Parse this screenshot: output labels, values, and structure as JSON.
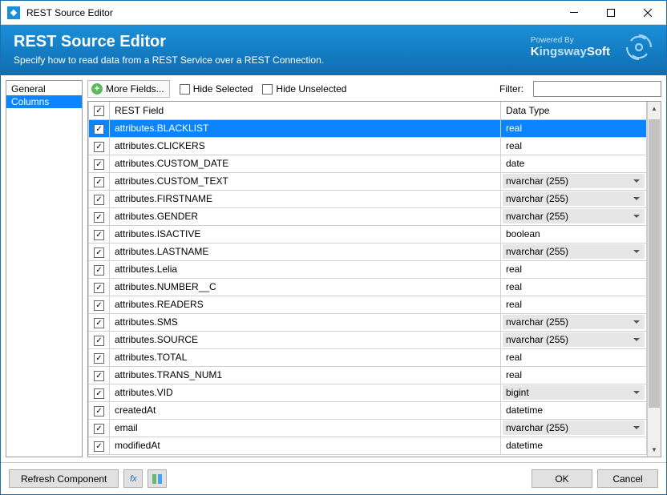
{
  "window": {
    "title": "REST Source Editor"
  },
  "header": {
    "title": "REST Source Editor",
    "subtitle": "Specify how to read data from a REST Service over a REST Connection.",
    "powered_by": "Powered By",
    "brand_part1": "K",
    "brand_part2": "ingsway",
    "brand_part3": "Soft"
  },
  "sidetabs": [
    {
      "label": "General",
      "active": false
    },
    {
      "label": "Columns",
      "active": true
    }
  ],
  "toolbar": {
    "more_fields": "More Fields...",
    "hide_selected": "Hide Selected",
    "hide_unselected": "Hide Unselected",
    "filter_label": "Filter:",
    "filter_value": ""
  },
  "columns": {
    "header_check": true,
    "col1": "REST Field",
    "col2": "Data Type"
  },
  "rows": [
    {
      "checked": true,
      "field": "attributes.BLACKLIST",
      "type": "real",
      "combo": false,
      "selected": true
    },
    {
      "checked": true,
      "field": "attributes.CLICKERS",
      "type": "real",
      "combo": false
    },
    {
      "checked": true,
      "field": "attributes.CUSTOM_DATE",
      "type": "date",
      "combo": false
    },
    {
      "checked": true,
      "field": "attributes.CUSTOM_TEXT",
      "type": "nvarchar (255)",
      "combo": true
    },
    {
      "checked": true,
      "field": "attributes.FIRSTNAME",
      "type": "nvarchar (255)",
      "combo": true
    },
    {
      "checked": true,
      "field": "attributes.GENDER",
      "type": "nvarchar (255)",
      "combo": true
    },
    {
      "checked": true,
      "field": "attributes.ISACTIVE",
      "type": "boolean",
      "combo": false
    },
    {
      "checked": true,
      "field": "attributes.LASTNAME",
      "type": "nvarchar (255)",
      "combo": true
    },
    {
      "checked": true,
      "field": "attributes.Lelia",
      "type": "real",
      "combo": false
    },
    {
      "checked": true,
      "field": "attributes.NUMBER__C",
      "type": "real",
      "combo": false
    },
    {
      "checked": true,
      "field": "attributes.READERS",
      "type": "real",
      "combo": false
    },
    {
      "checked": true,
      "field": "attributes.SMS",
      "type": "nvarchar (255)",
      "combo": true
    },
    {
      "checked": true,
      "field": "attributes.SOURCE",
      "type": "nvarchar (255)",
      "combo": true
    },
    {
      "checked": true,
      "field": "attributes.TOTAL",
      "type": "real",
      "combo": false
    },
    {
      "checked": true,
      "field": "attributes.TRANS_NUM1",
      "type": "real",
      "combo": false
    },
    {
      "checked": true,
      "field": "attributes.VID",
      "type": "bigint",
      "combo": true
    },
    {
      "checked": true,
      "field": "createdAt",
      "type": "datetime",
      "combo": false
    },
    {
      "checked": true,
      "field": "email",
      "type": "nvarchar (255)",
      "combo": true
    },
    {
      "checked": true,
      "field": "modifiedAt",
      "type": "datetime",
      "combo": false
    }
  ],
  "footer": {
    "refresh": "Refresh Component",
    "ok": "OK",
    "cancel": "Cancel"
  }
}
